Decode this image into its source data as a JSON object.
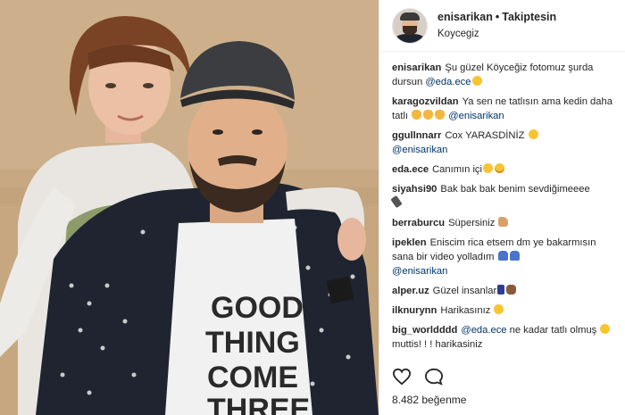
{
  "header": {
    "username": "enisarikan",
    "separator": "•",
    "follow_label": "Takiptesin",
    "location": "Koycegiz"
  },
  "comments": [
    {
      "user": "enisarikan",
      "text": "Şu güzel Köyceğiz fotomuz şurda dursun",
      "mention": "@eda.ece",
      "emoji": [
        "smile"
      ]
    },
    {
      "user": "karagozvildan",
      "text": "Ya sen ne tatlısın ama kedin daha tatlı",
      "emoji": [
        "cat",
        "cat",
        "cat"
      ],
      "mention": "@enisarikan"
    },
    {
      "user": "ggullnnarr",
      "text": "Cox YARASDİNİZ",
      "emoji": [
        "smile"
      ],
      "mention": "@enisarikan"
    },
    {
      "user": "eda.ece",
      "text": "Canımın içi",
      "emoji": [
        "smile",
        "heart-eyes"
      ]
    },
    {
      "user": "siyahsi90",
      "text": "Bak bak bak benim sevdiğimeeee",
      "emoji": [
        "pen"
      ]
    },
    {
      "user": "berraburcu",
      "text": "Süpersiniz",
      "emoji": [
        "thumb"
      ]
    },
    {
      "user": "ipeklen",
      "text": "Eniscim rica etsem dm ye bakarmısın sana bir video yolladım",
      "emoji": [
        "people",
        "people"
      ],
      "mention": "@enisarikan"
    },
    {
      "user": "alper.uz",
      "text": "Güzel insanlar",
      "emoji": [
        "ribbon",
        "fist"
      ]
    },
    {
      "user": "ilknurynn",
      "text": "Harikasınız",
      "emoji": [
        "smile"
      ]
    },
    {
      "user": "big_worldddd",
      "mention": "@eda.ece",
      "text": "ne kadar tatlı olmuş",
      "text2": "muttis! ! ! harikasiniz",
      "emoji": [
        "smile"
      ]
    }
  ],
  "likes": {
    "count": "8.482",
    "label": "beğenme"
  }
}
